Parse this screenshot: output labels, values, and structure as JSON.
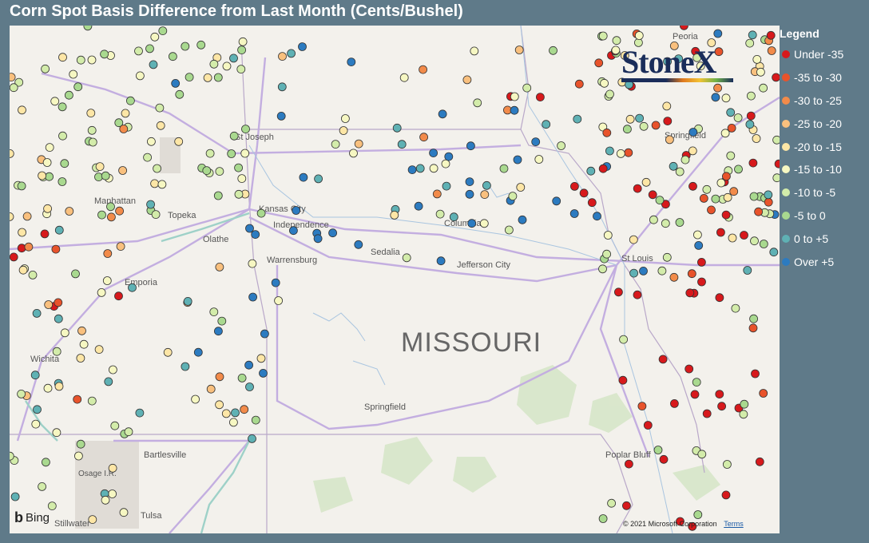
{
  "title": "Corn Spot Basis Difference from Last Month (Cents/Bushel)",
  "legend": {
    "title": "Legend",
    "items": [
      {
        "label": "Under -35",
        "color": "#d7191c"
      },
      {
        "label": "-35 to -30",
        "color": "#e8532b"
      },
      {
        "label": "-30 to -25",
        "color": "#f28b4a"
      },
      {
        "label": "-25 to -20",
        "color": "#f9c07e"
      },
      {
        "label": "-20 to -15",
        "color": "#fde6a6"
      },
      {
        "label": "-15 to -10",
        "color": "#f6f7c2"
      },
      {
        "label": "-10 to -5",
        "color": "#d3ecaa"
      },
      {
        "label": "-5 to 0",
        "color": "#a9d98f"
      },
      {
        "label": "0 to +5",
        "color": "#5fb1b4"
      },
      {
        "label": "Over +5",
        "color": "#2c7bc0"
      }
    ]
  },
  "logo": {
    "text": "StoneX"
  },
  "attribution": {
    "bing": "Bing",
    "copyright": "© 2021 Microsoft Corporation",
    "terms": "Terms"
  },
  "map_labels": {
    "state": "MISSOURI",
    "places": [
      "Peoria",
      "Springfield",
      "St Joseph",
      "Manhattan",
      "Topeka",
      "Kansas City",
      "Independence",
      "Olathe",
      "Columbia",
      "Warrensburg",
      "Sedalia",
      "Jefferson City",
      "St Louis",
      "Emporia",
      "Wichita",
      "Springfield",
      "Bartlesville",
      "Osage I.R.",
      "Poplar Bluff",
      "Tulsa",
      "Stillwater"
    ]
  }
}
